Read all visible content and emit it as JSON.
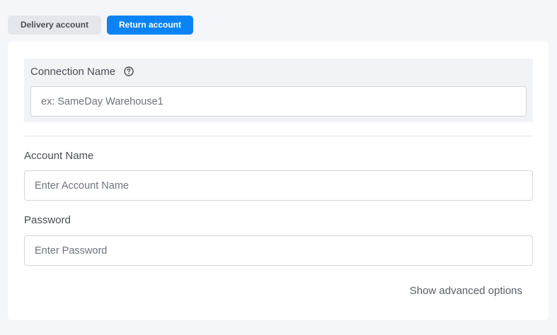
{
  "tabs": {
    "delivery_label": "Delivery account",
    "return_label": "Return account"
  },
  "connection": {
    "label": "Connection Name",
    "help_icon": "question-circle-icon",
    "placeholder": "ex: SameDay Warehouse1"
  },
  "account": {
    "label": "Account Name",
    "placeholder": "Enter Account Name"
  },
  "password": {
    "label": "Password",
    "placeholder": "Enter Password"
  },
  "advanced": {
    "label": "Show advanced options"
  },
  "colors": {
    "accent": "#0a84f4",
    "page_bg": "#f4f6fa",
    "section_bg": "#f1f3f7"
  }
}
